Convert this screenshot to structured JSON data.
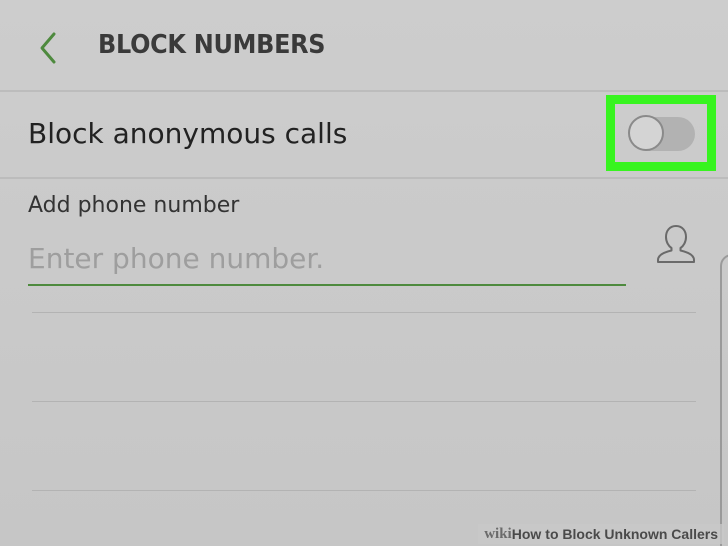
{
  "header": {
    "title": "BLOCK NUMBERS",
    "back_icon": "chevron-left-icon"
  },
  "anonymous": {
    "label": "Block anonymous calls",
    "toggle_on": false,
    "highlight_color": "#37f41f"
  },
  "add_number": {
    "label": "Add phone number",
    "placeholder": "Enter phone number.",
    "value": "",
    "contact_icon": "contact-person-icon"
  },
  "colors": {
    "accent": "#4e8a3e",
    "background": "#c9c9c9"
  },
  "watermark": {
    "brand": "wiki",
    "how": "How",
    "rest": "to Block Unknown Callers"
  }
}
